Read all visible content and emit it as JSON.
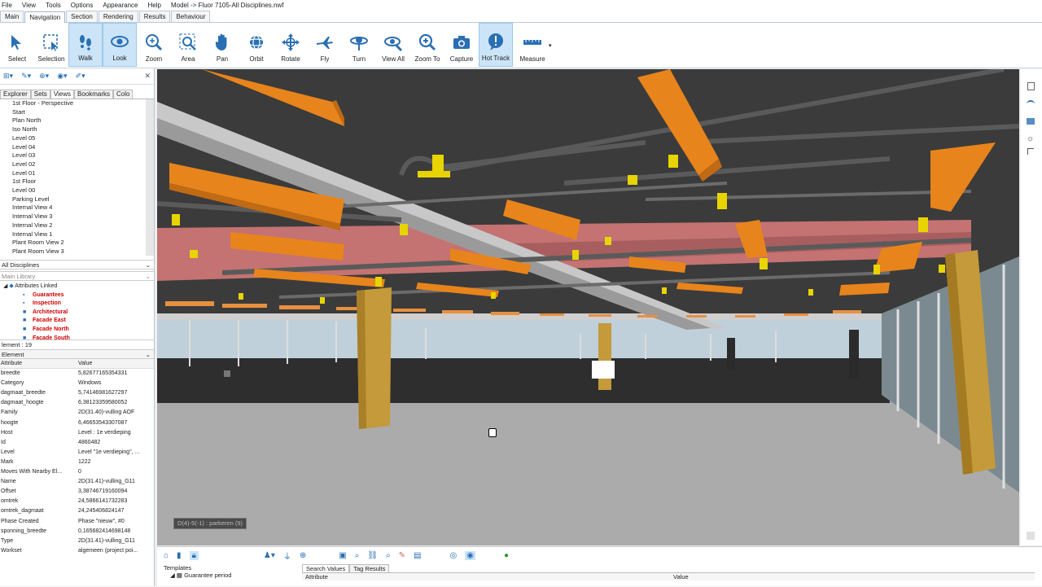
{
  "menu": [
    "File",
    "View",
    "Tools",
    "Options",
    "Appearance",
    "Help",
    "Model -> Fluor 7105-All Disciplines.nwf"
  ],
  "tabs": [
    {
      "label": "Main",
      "active": false
    },
    {
      "label": "Navigation",
      "active": true
    },
    {
      "label": "Section",
      "active": false
    },
    {
      "label": "Rendering",
      "active": false
    },
    {
      "label": "Results",
      "active": false
    },
    {
      "label": "Behaviour",
      "active": false
    }
  ],
  "ribbon": [
    {
      "label": "Select",
      "icon": "cursor-icon",
      "on": false
    },
    {
      "label": "Selection",
      "icon": "selection-box-icon",
      "on": false
    },
    {
      "label": "Walk",
      "icon": "footprints-icon",
      "on": true
    },
    {
      "label": "Look",
      "icon": "eye-icon",
      "on": true
    },
    {
      "label": "Zoom",
      "icon": "zoom-icon",
      "on": false
    },
    {
      "label": "Area",
      "icon": "zoom-area-icon",
      "on": false
    },
    {
      "label": "Pan",
      "icon": "hand-icon",
      "on": false
    },
    {
      "label": "Orbit",
      "icon": "orbit-icon",
      "on": false
    },
    {
      "label": "Rotate",
      "icon": "rotate-icon",
      "on": false
    },
    {
      "label": "Fly",
      "icon": "plane-icon",
      "on": false
    },
    {
      "label": "Turn",
      "icon": "turn-icon",
      "on": false
    },
    {
      "label": "View All",
      "icon": "view-all-icon",
      "on": false
    },
    {
      "label": "Zoom To",
      "icon": "zoom-to-icon",
      "on": false
    },
    {
      "label": "Capture",
      "icon": "camera-icon",
      "on": false
    },
    {
      "label": "Hot Track",
      "icon": "hot-track-icon",
      "on": true
    },
    {
      "label": "Measure",
      "icon": "ruler-icon",
      "on": false
    }
  ],
  "left": {
    "tabs": [
      "Explorer",
      "Sets",
      "Views",
      "Bookmarks",
      "Colo"
    ],
    "views": [
      "1st Floor - Perspective",
      "Start",
      "Plan North",
      "Iso North",
      "Level 05",
      "Level 04",
      "Level 03",
      "Level 02",
      "Level 01",
      "1st Floor",
      "Level 00",
      "Parking Level",
      "Internal View 4",
      "Internal View 3",
      "Internal View 2",
      "Internal View 1",
      "Plant Room View 2",
      "Plant Room View 3"
    ],
    "discipline": "All Disciplines",
    "library": "Main Library",
    "tree_root": "Attributes Linked",
    "tree_items": [
      "Guarantees",
      "Inspection",
      "Architectural",
      "Facade East",
      "Facade North",
      "Facade South"
    ],
    "element_count": "lement : 19",
    "element_label": "Element",
    "col_attr": "Attribute",
    "col_value": "Value",
    "properties": [
      {
        "k": "breedte",
        "v": "5,82677165354331"
      },
      {
        "k": "Category",
        "v": "Windows"
      },
      {
        "k": "dagmaat_breedte",
        "v": "5,74146981627297"
      },
      {
        "k": "dagmaat_hoogte",
        "v": "6,38123359580052"
      },
      {
        "k": "Family",
        "v": "2D(31.40)-vulling AOF"
      },
      {
        "k": "hoogte",
        "v": "6,46653543307087"
      },
      {
        "k": "Host",
        "v": "Level : 1e verdieping"
      },
      {
        "k": "Id",
        "v": "4860482"
      },
      {
        "k": "Level",
        "v": "Level \"1e verdieping\", ..."
      },
      {
        "k": "Mark",
        "v": "1222"
      },
      {
        "k": "Moves With Nearby El...",
        "v": "0"
      },
      {
        "k": "Name",
        "v": "2D(31.41)-vulling_G11"
      },
      {
        "k": "Offset",
        "v": "3,38746719160094"
      },
      {
        "k": "omtrek",
        "v": "24,5866141732283"
      },
      {
        "k": "omtrek_dagmaat",
        "v": "24,245406824147"
      },
      {
        "k": "Phase Created",
        "v": "Phase \"nieuw\", #0"
      },
      {
        "k": "sponning_breedte",
        "v": "0,165682414698148"
      },
      {
        "k": "Type",
        "v": "2D(31.41)-vulling_G11"
      },
      {
        "k": "Workset",
        "v": "algemeen (project poi..."
      }
    ]
  },
  "viewport": {
    "label": "D(4)-5(-1) : parkeren (9)"
  },
  "bottom": {
    "templates": "Templates",
    "guarantee": "Guarantee period",
    "tabs": [
      "Search Values",
      "Tag Results"
    ],
    "col_attr": "Attribute",
    "col_value": "Value"
  },
  "colors": {
    "beam": "#e8841c",
    "pipe": "#555555",
    "fitting": "#e8d400",
    "duct": "#c77070",
    "column": "#c49a3a",
    "floor": "#a6a6a6",
    "ceiling": "#3a3a3a",
    "tree_red": "#d00000",
    "active": "#cce4f7"
  }
}
